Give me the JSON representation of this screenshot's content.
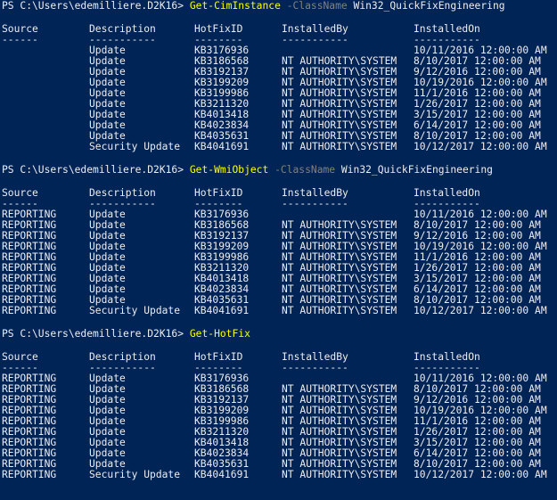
{
  "headers": {
    "source": "Source",
    "description": "Description",
    "hotfixid": "HotFixID",
    "installedby": "InstalledBy",
    "installedon": "InstalledOn"
  },
  "separators": {
    "source": "------",
    "description": "-----------",
    "hotfixid": "--------",
    "installedby": "-----------",
    "installedon": "-----------"
  },
  "sections": [
    {
      "prompt": "PS C:\\Users\\edemilliere.D2K16>",
      "command": "Get-CimInstance",
      "parameter": "-ClassName",
      "argument": "Win32_QuickFixEngineering",
      "rows": [
        {
          "source": "",
          "description": "Update",
          "hotfixid": "KB3176936",
          "installedby": "",
          "installedon": "10/11/2016 12:00:00 AM"
        },
        {
          "source": "",
          "description": "Update",
          "hotfixid": "KB3186568",
          "installedby": "NT AUTHORITY\\SYSTEM",
          "installedon": "8/10/2017 12:00:00 AM"
        },
        {
          "source": "",
          "description": "Update",
          "hotfixid": "KB3192137",
          "installedby": "NT AUTHORITY\\SYSTEM",
          "installedon": "9/12/2016 12:00:00 AM"
        },
        {
          "source": "",
          "description": "Update",
          "hotfixid": "KB3199209",
          "installedby": "NT AUTHORITY\\SYSTEM",
          "installedon": "10/19/2016 12:00:00 AM"
        },
        {
          "source": "",
          "description": "Update",
          "hotfixid": "KB3199986",
          "installedby": "NT AUTHORITY\\SYSTEM",
          "installedon": "11/1/2016 12:00:00 AM"
        },
        {
          "source": "",
          "description": "Update",
          "hotfixid": "KB3211320",
          "installedby": "NT AUTHORITY\\SYSTEM",
          "installedon": "1/26/2017 12:00:00 AM"
        },
        {
          "source": "",
          "description": "Update",
          "hotfixid": "KB4013418",
          "installedby": "NT AUTHORITY\\SYSTEM",
          "installedon": "3/15/2017 12:00:00 AM"
        },
        {
          "source": "",
          "description": "Update",
          "hotfixid": "KB4023834",
          "installedby": "NT AUTHORITY\\SYSTEM",
          "installedon": "6/14/2017 12:00:00 AM"
        },
        {
          "source": "",
          "description": "Update",
          "hotfixid": "KB4035631",
          "installedby": "NT AUTHORITY\\SYSTEM",
          "installedon": "8/10/2017 12:00:00 AM"
        },
        {
          "source": "",
          "description": "Security Update",
          "hotfixid": "KB4041691",
          "installedby": "NT AUTHORITY\\SYSTEM",
          "installedon": "10/12/2017 12:00:00 AM"
        }
      ]
    },
    {
      "prompt": "PS C:\\Users\\edemilliere.D2K16>",
      "command": "Get-WmiObject",
      "parameter": "-ClassName",
      "argument": "Win32_QuickFixEngineering",
      "rows": [
        {
          "source": "REPORTING",
          "description": "Update",
          "hotfixid": "KB3176936",
          "installedby": "",
          "installedon": "10/11/2016 12:00:00 AM"
        },
        {
          "source": "REPORTING",
          "description": "Update",
          "hotfixid": "KB3186568",
          "installedby": "NT AUTHORITY\\SYSTEM",
          "installedon": "8/10/2017 12:00:00 AM"
        },
        {
          "source": "REPORTING",
          "description": "Update",
          "hotfixid": "KB3192137",
          "installedby": "NT AUTHORITY\\SYSTEM",
          "installedon": "9/12/2016 12:00:00 AM"
        },
        {
          "source": "REPORTING",
          "description": "Update",
          "hotfixid": "KB3199209",
          "installedby": "NT AUTHORITY\\SYSTEM",
          "installedon": "10/19/2016 12:00:00 AM"
        },
        {
          "source": "REPORTING",
          "description": "Update",
          "hotfixid": "KB3199986",
          "installedby": "NT AUTHORITY\\SYSTEM",
          "installedon": "11/1/2016 12:00:00 AM"
        },
        {
          "source": "REPORTING",
          "description": "Update",
          "hotfixid": "KB3211320",
          "installedby": "NT AUTHORITY\\SYSTEM",
          "installedon": "1/26/2017 12:00:00 AM"
        },
        {
          "source": "REPORTING",
          "description": "Update",
          "hotfixid": "KB4013418",
          "installedby": "NT AUTHORITY\\SYSTEM",
          "installedon": "3/15/2017 12:00:00 AM"
        },
        {
          "source": "REPORTING",
          "description": "Update",
          "hotfixid": "KB4023834",
          "installedby": "NT AUTHORITY\\SYSTEM",
          "installedon": "6/14/2017 12:00:00 AM"
        },
        {
          "source": "REPORTING",
          "description": "Update",
          "hotfixid": "KB4035631",
          "installedby": "NT AUTHORITY\\SYSTEM",
          "installedon": "8/10/2017 12:00:00 AM"
        },
        {
          "source": "REPORTING",
          "description": "Security Update",
          "hotfixid": "KB4041691",
          "installedby": "NT AUTHORITY\\SYSTEM",
          "installedon": "10/12/2017 12:00:00 AM"
        }
      ]
    },
    {
      "prompt": "PS C:\\Users\\edemilliere.D2K16>",
      "command": "Get-HotFix",
      "parameter": "",
      "argument": "",
      "rows": [
        {
          "source": "REPORTING",
          "description": "Update",
          "hotfixid": "KB3176936",
          "installedby": "",
          "installedon": "10/11/2016 12:00:00 AM"
        },
        {
          "source": "REPORTING",
          "description": "Update",
          "hotfixid": "KB3186568",
          "installedby": "NT AUTHORITY\\SYSTEM",
          "installedon": "8/10/2017 12:00:00 AM"
        },
        {
          "source": "REPORTING",
          "description": "Update",
          "hotfixid": "KB3192137",
          "installedby": "NT AUTHORITY\\SYSTEM",
          "installedon": "9/12/2016 12:00:00 AM"
        },
        {
          "source": "REPORTING",
          "description": "Update",
          "hotfixid": "KB3199209",
          "installedby": "NT AUTHORITY\\SYSTEM",
          "installedon": "10/19/2016 12:00:00 AM"
        },
        {
          "source": "REPORTING",
          "description": "Update",
          "hotfixid": "KB3199986",
          "installedby": "NT AUTHORITY\\SYSTEM",
          "installedon": "11/1/2016 12:00:00 AM"
        },
        {
          "source": "REPORTING",
          "description": "Update",
          "hotfixid": "KB3211320",
          "installedby": "NT AUTHORITY\\SYSTEM",
          "installedon": "1/26/2017 12:00:00 AM"
        },
        {
          "source": "REPORTING",
          "description": "Update",
          "hotfixid": "KB4013418",
          "installedby": "NT AUTHORITY\\SYSTEM",
          "installedon": "3/15/2017 12:00:00 AM"
        },
        {
          "source": "REPORTING",
          "description": "Update",
          "hotfixid": "KB4023834",
          "installedby": "NT AUTHORITY\\SYSTEM",
          "installedon": "6/14/2017 12:00:00 AM"
        },
        {
          "source": "REPORTING",
          "description": "Update",
          "hotfixid": "KB4035631",
          "installedby": "NT AUTHORITY\\SYSTEM",
          "installedon": "8/10/2017 12:00:00 AM"
        },
        {
          "source": "REPORTING",
          "description": "Security Update",
          "hotfixid": "KB4041691",
          "installedby": "NT AUTHORITY\\SYSTEM",
          "installedon": "10/12/2017 12:00:00 AM"
        }
      ]
    }
  ],
  "colors": {
    "background": "#012456",
    "text": "#eeedf0",
    "command": "#ffff00",
    "parameter": "#808080"
  }
}
